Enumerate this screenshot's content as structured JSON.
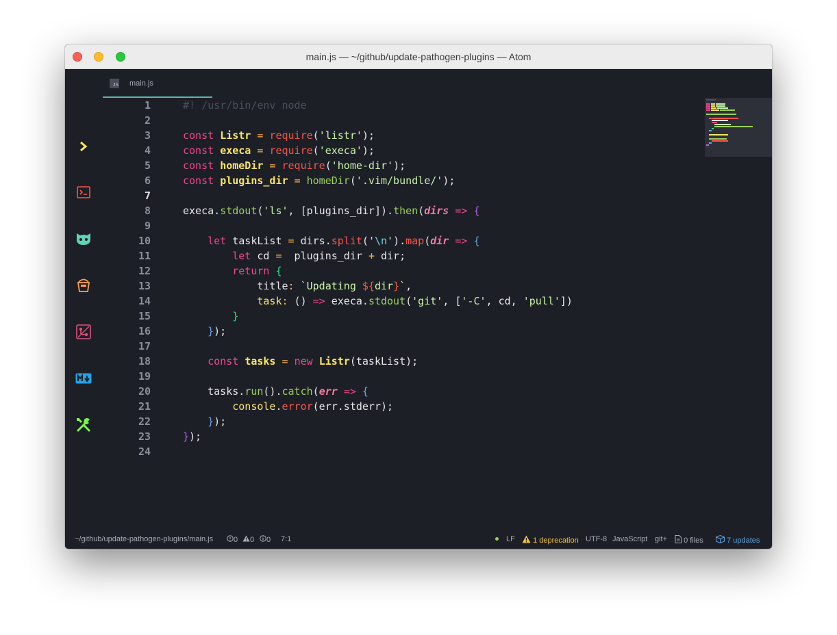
{
  "window": {
    "title": "main.js — ~/github/update-pathogen-plugins — Atom"
  },
  "tab": {
    "label": "main.js",
    "icon_text": "JS"
  },
  "activity_bar": [
    {
      "name": "chevron-right-icon",
      "color": "#fce566"
    },
    {
      "name": "terminal-icon",
      "color": "#f6584a"
    },
    {
      "name": "github-icon",
      "color": "#5fd3b5"
    },
    {
      "name": "bucket-icon",
      "color": "#ffa04a"
    },
    {
      "name": "git-branch-icon",
      "color": "#e0527a"
    },
    {
      "name": "markdown-icon",
      "color": "#1fa3e8"
    },
    {
      "name": "tools-icon",
      "color": "#7ff34a"
    }
  ],
  "editor": {
    "active_line": 7,
    "line_numbers": [
      "1",
      "2",
      "3",
      "4",
      "5",
      "6",
      "7",
      "8",
      "9",
      "10",
      "11",
      "12",
      "13",
      "14",
      "15",
      "16",
      "17",
      "18",
      "19",
      "20",
      "21",
      "22",
      "23",
      "24"
    ],
    "lines": [
      "#! /usr/bin/env node",
      "",
      "const Listr = require('listr');",
      "const execa = require('execa');",
      "const homeDir = require('home-dir');",
      "const plugins_dir = homeDir('.vim/bundle/');",
      "",
      "execa.stdout('ls', [plugins_dir]).then(dirs => {",
      "",
      "    let taskList = dirs.split('\\n').map(dir => {",
      "        let cd =  plugins_dir + dir;",
      "        return {",
      "            title: `Updating ${dir}`,",
      "            task: () => execa.stdout('git', ['-C', cd, 'pull'])",
      "        }",
      "    });",
      "",
      "    const tasks = new Listr(taskList);",
      "",
      "    tasks.run().catch(err => {",
      "        console.error(err.stderr);",
      "    });",
      "});",
      ""
    ]
  },
  "statusbar": {
    "path": "~/github/update-pathogen-plugins/main.js",
    "errors": "0",
    "warnings": "0",
    "infos": "0",
    "cursor": "7:1",
    "line_ending": "LF",
    "deprecation": "1 deprecation",
    "encoding": "UTF-8",
    "grammar": "JavaScript",
    "git": "git+",
    "files": "0 files",
    "updates": "7 updates"
  },
  "colors": {
    "editor_bg": "#1d1f27",
    "keyword": "#f0478a",
    "variable": "#fce566",
    "function": "#f6584a",
    "string": "#c9f5a8",
    "accent": "#5fb3b3",
    "warning": "#f5c33b",
    "info": "#5aa7e8"
  }
}
